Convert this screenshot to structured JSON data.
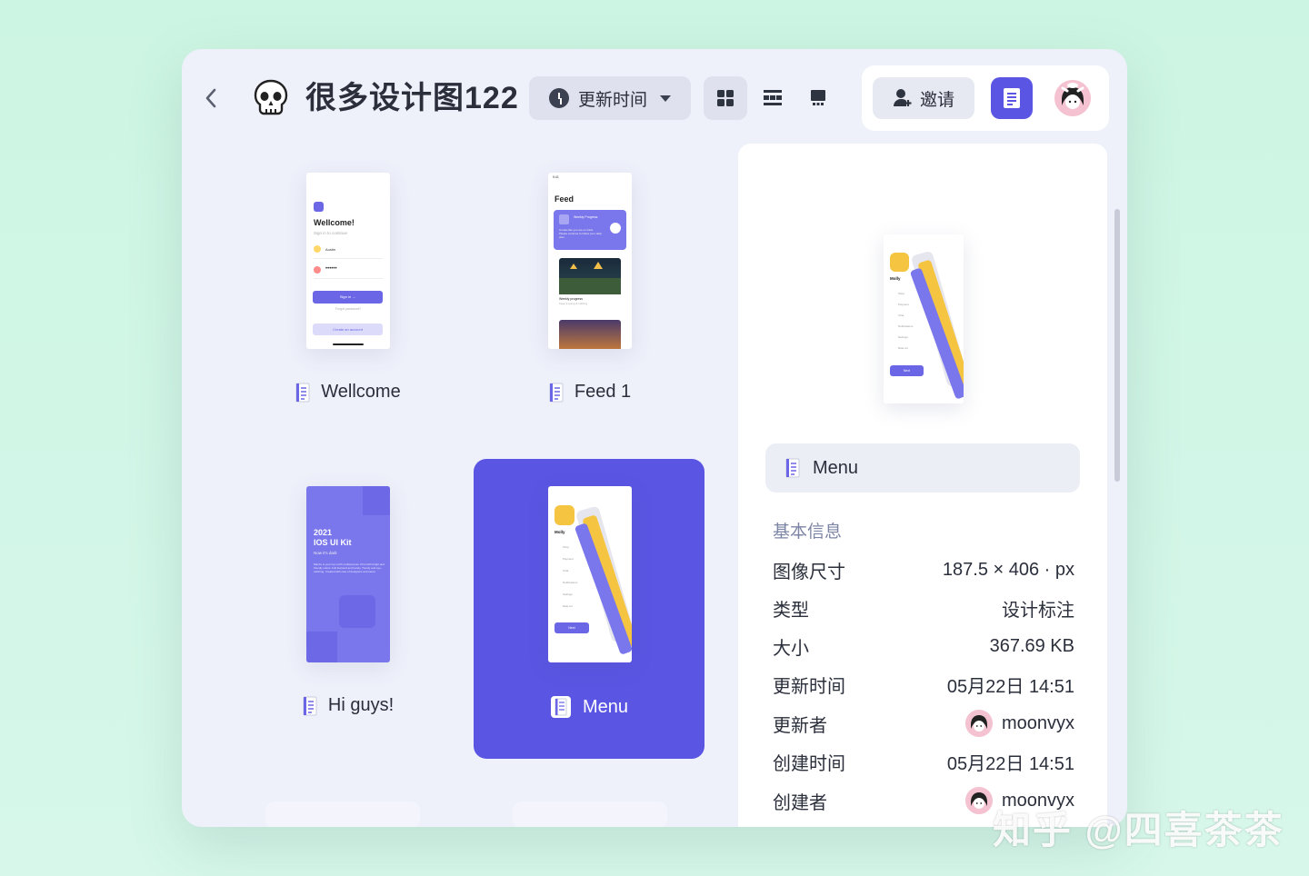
{
  "header": {
    "title": "很多设计图122",
    "sort_label": "更新时间",
    "invite_label": "邀请"
  },
  "grid": {
    "items": [
      {
        "label": "Wellcome",
        "selected": false
      },
      {
        "label": "Feed 1",
        "selected": false
      },
      {
        "label": "Hi guys!",
        "selected": false
      },
      {
        "label": "Menu",
        "selected": true
      }
    ]
  },
  "thumbs": {
    "wellcome": {
      "heading": "Wellcome!",
      "sub": "Sign in to continue",
      "name": "Austin",
      "password": "••••••",
      "signin": "Sign in →",
      "forgot": "Forgot password?",
      "create": "Create an account"
    },
    "feed": {
      "time": "9:41",
      "heading": "Feed",
      "card_title": "Weekly Progress",
      "card_text": "It looks like you are on track. Please continue to follow your daily plan.",
      "item_title": "Weekly progress",
      "item_sub": "Keep it going & nothing"
    },
    "higuys": {
      "year": "2021",
      "kit": "IOS UI Kit",
      "sub": "Now it's dark",
      "text": "Marvie is your top notch multipurpose UI kit with bright and friendly colors. Full featured and handy. Trendy and eye-catching. Created with care of designers and users."
    },
    "menu": {
      "name": "Molly",
      "items": [
        "Shop",
        "Payment",
        "Chat",
        "Notifications",
        "Settings",
        "Rate Us"
      ],
      "button": "Next"
    }
  },
  "panel": {
    "file_name": "Menu",
    "section_title": "基本信息",
    "rows": [
      {
        "label": "图像尺寸",
        "value": "187.5 × 406 · px"
      },
      {
        "label": "类型",
        "value": "设计标注"
      },
      {
        "label": "大小",
        "value": "367.69 KB"
      },
      {
        "label": "更新时间",
        "value": "05月22日 14:51"
      },
      {
        "label": "更新者",
        "value": "moonvyx"
      },
      {
        "label": "创建时间",
        "value": "05月22日 14:51"
      },
      {
        "label": "创建者",
        "value": "moonvyx"
      }
    ]
  },
  "watermark": "知乎 @四喜茶茶",
  "colors": {
    "accent": "#5a55e3",
    "background": "#eef0fa",
    "page": "#cdf5e3"
  },
  "icons": [
    "back-icon",
    "skull-icon",
    "clock-icon",
    "caret-down-icon",
    "grid-view-icon",
    "list-view-icon",
    "presentation-view-icon",
    "add-user-icon",
    "document-icon",
    "avatar"
  ]
}
